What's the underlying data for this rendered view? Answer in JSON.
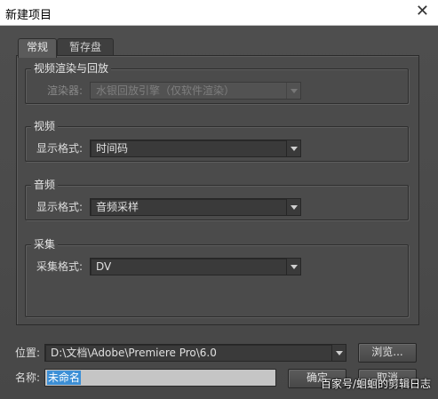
{
  "window": {
    "title": "新建项目",
    "close_glyph": "✕"
  },
  "tabs": [
    {
      "label": "常规",
      "active": true
    },
    {
      "label": "暂存盘",
      "active": false
    }
  ],
  "groups": {
    "video_render": {
      "legend": "视频渲染与回放",
      "field_label": "渲染器:",
      "value": "水银回放引擎（仅软件渲染）",
      "disabled": true
    },
    "video": {
      "legend": "视频",
      "field_label": "显示格式:",
      "value": "时间码"
    },
    "audio": {
      "legend": "音频",
      "field_label": "显示格式:",
      "value": "音频采样"
    },
    "capture": {
      "legend": "采集",
      "field_label": "采集格式:",
      "value": "DV"
    }
  },
  "location": {
    "label": "位置:",
    "value": "D:\\文档\\Adobe\\Premiere Pro\\6.0",
    "browse_label": "浏览..."
  },
  "name": {
    "label": "名称:",
    "value": "未命名"
  },
  "buttons": {
    "ok_label": "确定",
    "cancel_label": "取消"
  },
  "watermark": "百家号/蛔蛔的剪辑日志",
  "colors": {
    "dialog_bg": "#4b4b4b",
    "selection": "#3c8fd6",
    "titlebar_bg": "#ffffff"
  }
}
